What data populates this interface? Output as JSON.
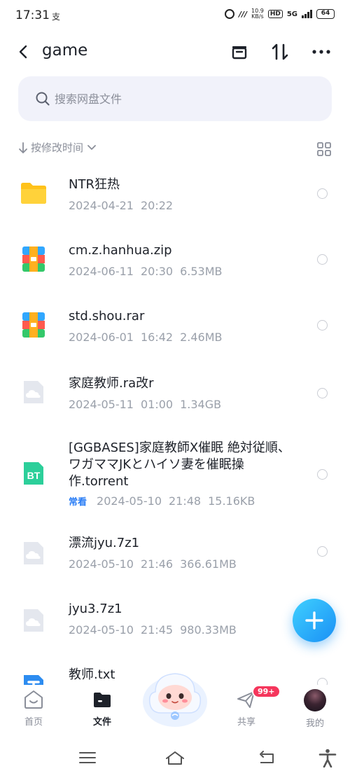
{
  "status_bar": {
    "time": "17:31",
    "note_glyph": "支",
    "net_speed_value": "10.9",
    "net_speed_unit": "KB/s",
    "hd_label": "HD",
    "network_type": "5G",
    "battery": "64",
    "icons": [
      "alarm-icon",
      "signal-icon",
      "battery-icon"
    ]
  },
  "header": {
    "title": "game",
    "icons": [
      "back-icon",
      "archive-icon",
      "sort-toggle-icon",
      "more-icon"
    ]
  },
  "search": {
    "placeholder": "搜索网盘文件"
  },
  "sort": {
    "label": "按修改时间",
    "icons": [
      "arrow-down-icon",
      "chevron-down-icon",
      "grid-view-icon"
    ]
  },
  "files": [
    {
      "name": "NTR狂热",
      "date": "2024-04-21",
      "time": "20:22",
      "size": "",
      "type": "folder"
    },
    {
      "name": "cm.z.hanhua.zip",
      "date": "2024-06-11",
      "time": "20:30",
      "size": "6.53MB",
      "type": "archive"
    },
    {
      "name": "std.shou.rar",
      "date": "2024-06-01",
      "time": "16:42",
      "size": "2.46MB",
      "type": "archive"
    },
    {
      "name": "家庭教师.ra改r",
      "date": "2024-05-11",
      "time": "01:00",
      "size": "1.34GB",
      "type": "unknown"
    },
    {
      "name": "[GGBASES]家庭教師X催眠 絶対従順、ワガママJKとハイソ妻を催眠操作.torrent",
      "badge": "常看",
      "date": "2024-05-10",
      "time": "21:48",
      "size": "15.16KB",
      "type": "torrent",
      "icon_text": "BT"
    },
    {
      "name": "漂流jyu.7z1",
      "date": "2024-05-10",
      "time": "21:46",
      "size": "366.61MB",
      "type": "unknown"
    },
    {
      "name": "jyu3.7z1",
      "date": "2024-05-10",
      "time": "21:45",
      "size": "980.33MB",
      "type": "unknown"
    },
    {
      "name": "教师.txt",
      "date": "",
      "time": "",
      "size": "",
      "type": "text"
    }
  ],
  "bottom_nav": {
    "home": "首页",
    "files": "文件",
    "share": "共享",
    "me": "我的",
    "share_badge": "99+",
    "active": "files"
  },
  "colors": {
    "accent": "#1a90f5",
    "search_bg": "#f1f2fa",
    "folder": "#ffc21a",
    "badge_red": "#f5365c"
  }
}
